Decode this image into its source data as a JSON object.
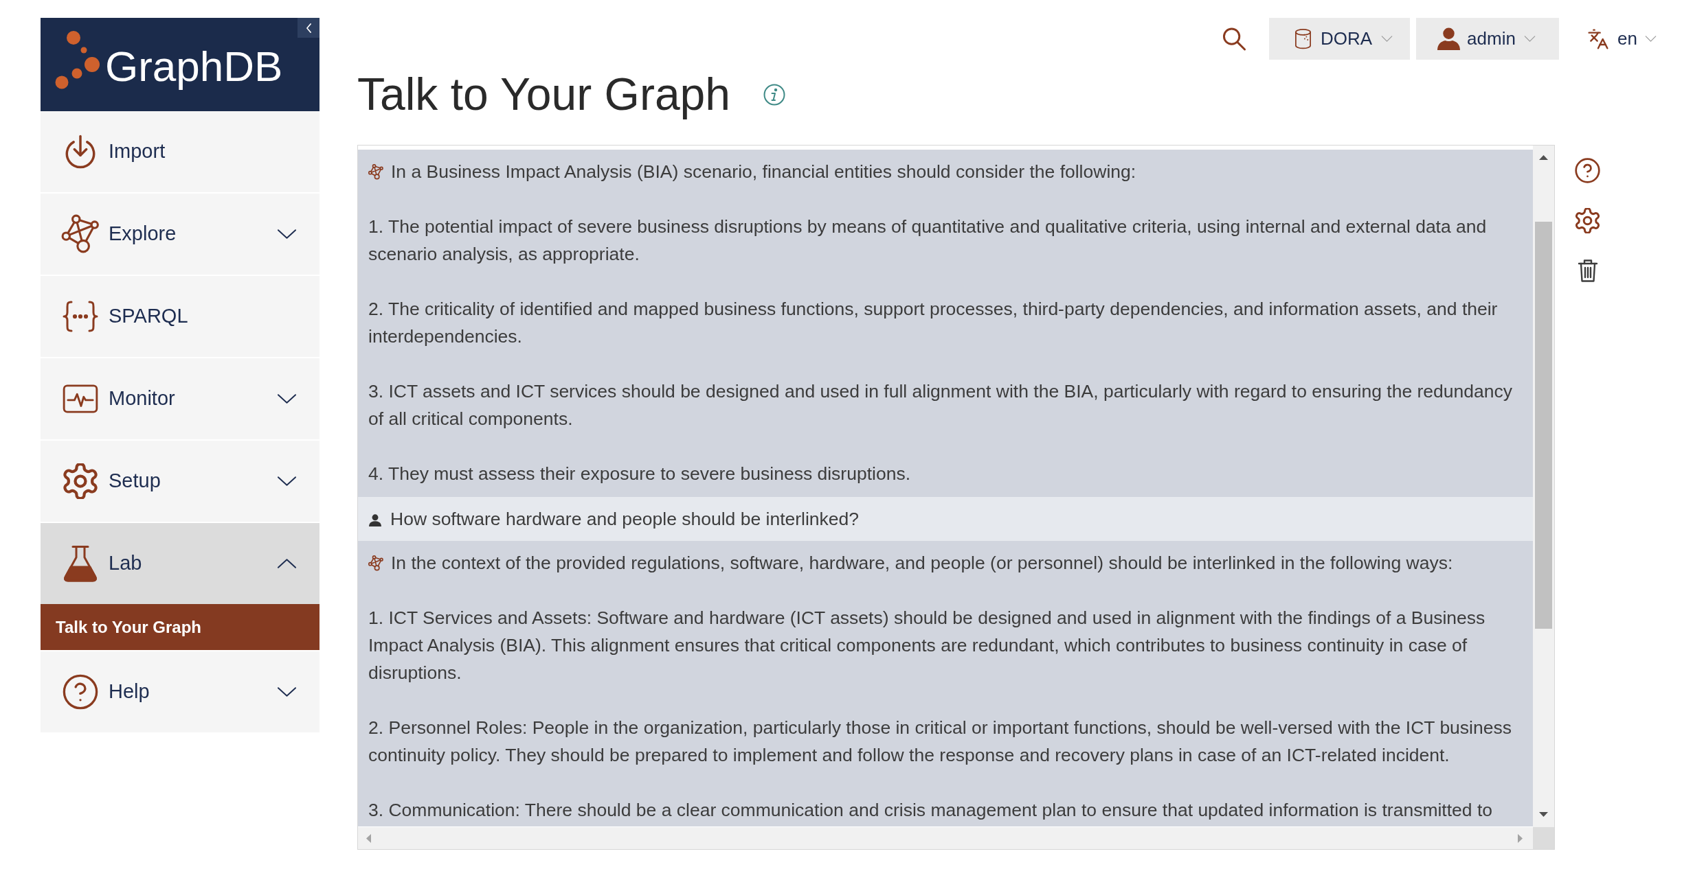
{
  "sidebar": {
    "logo_text": "GraphDB",
    "items": [
      {
        "label": "Import",
        "kind": "link"
      },
      {
        "label": "Explore",
        "kind": "group",
        "expanded": false
      },
      {
        "label": "SPARQL",
        "kind": "link"
      },
      {
        "label": "Monitor",
        "kind": "group",
        "expanded": false
      },
      {
        "label": "Setup",
        "kind": "group",
        "expanded": false
      },
      {
        "label": "Lab",
        "kind": "group",
        "expanded": true,
        "children": [
          {
            "label": "Talk to Your Graph",
            "selected": true
          }
        ]
      },
      {
        "label": "Help",
        "kind": "group",
        "expanded": false
      }
    ]
  },
  "top_bar": {
    "repository": "DORA",
    "user": "admin",
    "language": "en"
  },
  "page_title": "Talk to Your Graph",
  "chat": {
    "messages": [
      {
        "kind": "answer",
        "paragraphs": [
          "In a Business Impact Analysis (BIA) scenario, financial entities should consider the following:",
          "1. The potential impact of severe business disruptions by means of quantitative and qualitative criteria, using internal and external data and scenario analysis, as appropriate.",
          "2. The criticality of identified and mapped business functions, support processes, third-party dependencies, and information assets, and their interdependencies.",
          "3. ICT assets and ICT services should be designed and used in full alignment with the BIA, particularly with regard to ensuring the redundancy of all critical components.",
          "4. They must assess their exposure to severe business disruptions."
        ]
      },
      {
        "kind": "question",
        "paragraphs": [
          "How software hardware and people should be interlinked?"
        ]
      },
      {
        "kind": "answer",
        "paragraphs": [
          "In the context of the provided regulations, software, hardware, and people (or personnel) should be interlinked in the following ways:",
          "1. ICT Services and Assets: Software and hardware (ICT assets) should be designed and used in alignment with the findings of a Business Impact Analysis (BIA). This alignment ensures that critical components are redundant, which contributes to business continuity in case of disruptions.",
          "2. Personnel Roles: People in the organization, particularly those in critical or important functions, should be well-versed with the ICT business continuity policy. They should be prepared to implement and follow the response and recovery plans in case of an ICT-related incident.",
          "3. Communication: There should be a clear communication and crisis management plan to ensure that updated information is transmitted to"
        ]
      }
    ]
  }
}
